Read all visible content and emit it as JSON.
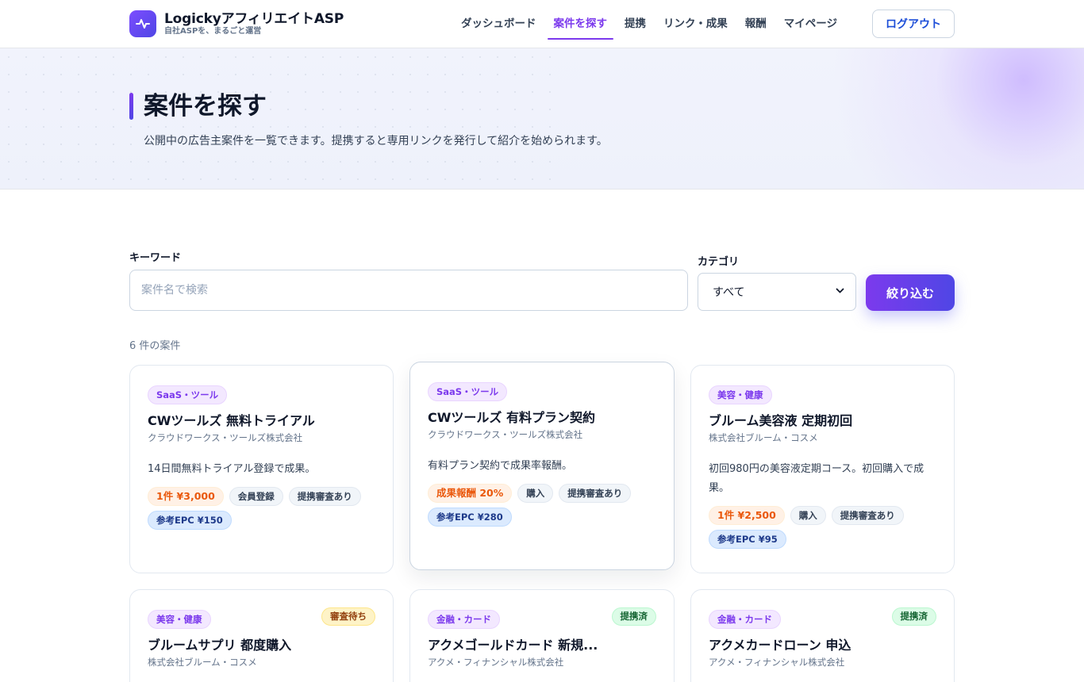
{
  "header": {
    "brand_name": "LogickyアフィリエイトASP",
    "brand_tagline": "自社ASPを、まるごと運営",
    "nav": [
      {
        "label": "ダッシュボード",
        "active": false
      },
      {
        "label": "案件を探す",
        "active": true
      },
      {
        "label": "提携",
        "active": false
      },
      {
        "label": "リンク・成果",
        "active": false
      },
      {
        "label": "報酬",
        "active": false
      },
      {
        "label": "マイページ",
        "active": false
      }
    ],
    "logout_label": "ログアウト"
  },
  "hero": {
    "title": "案件を探す",
    "subtitle": "公開中の広告主案件を一覧できます。提携すると専用リンクを発行して紹介を始められます。"
  },
  "filters": {
    "keyword_label": "キーワード",
    "keyword_placeholder": "案件名で検索",
    "keyword_value": "",
    "category_label": "カテゴリ",
    "category_value": "すべて",
    "submit_label": "絞り込む"
  },
  "results": {
    "count_text": "6 件の案件"
  },
  "cards": [
    {
      "category": "SaaS・ツール",
      "status": "",
      "title": "CWツールズ 無料トライアル",
      "company": "クラウドワークス・ツールズ株式会社",
      "description": "14日間無料トライアル登録で成果。",
      "reward": "1件 ¥3,000",
      "tags": [
        "会員登録",
        "提携審査あり"
      ],
      "epc": "参考EPC ¥150"
    },
    {
      "category": "SaaS・ツール",
      "status": "",
      "title": "CWツールズ 有料プラン契約",
      "company": "クラウドワークス・ツールズ株式会社",
      "description": "有料プラン契約で成果率報酬。",
      "reward": "成果報酬 20%",
      "tags": [
        "購入",
        "提携審査あり"
      ],
      "epc": "参考EPC ¥280"
    },
    {
      "category": "美容・健康",
      "status": "",
      "title": "ブルーム美容液 定期初回",
      "company": "株式会社ブルーム・コスメ",
      "description": "初回980円の美容液定期コース。初回購入で成果。",
      "reward": "1件 ¥2,500",
      "tags": [
        "購入",
        "提携審査あり"
      ],
      "epc": "参考EPC ¥95"
    },
    {
      "category": "美容・健康",
      "status": "審査待ち",
      "status_type": "pending",
      "title": "ブルームサプリ 都度購入",
      "company": "株式会社ブルーム・コスメ",
      "description": "",
      "reward": "",
      "tags": [],
      "epc": ""
    },
    {
      "category": "金融・カード",
      "status": "提携済",
      "status_type": "joined",
      "title": "アクメゴールドカード 新規...",
      "company": "アクメ・フィナンシャル株式会社",
      "description": "",
      "reward": "",
      "tags": [],
      "epc": ""
    },
    {
      "category": "金融・カード",
      "status": "提携済",
      "status_type": "joined",
      "title": "アクメカードローン 申込",
      "company": "アクメ・フィナンシャル株式会社",
      "description": "",
      "reward": "",
      "tags": [],
      "epc": ""
    }
  ],
  "icons": {
    "brand_logo": "pulse-icon",
    "select_caret": "chevron-down-icon"
  },
  "colors": {
    "accent": "#7c3aed",
    "accent_blue": "#4f46e5",
    "link_blue": "#1d4ed8",
    "reward_orange": "#ea580c"
  }
}
